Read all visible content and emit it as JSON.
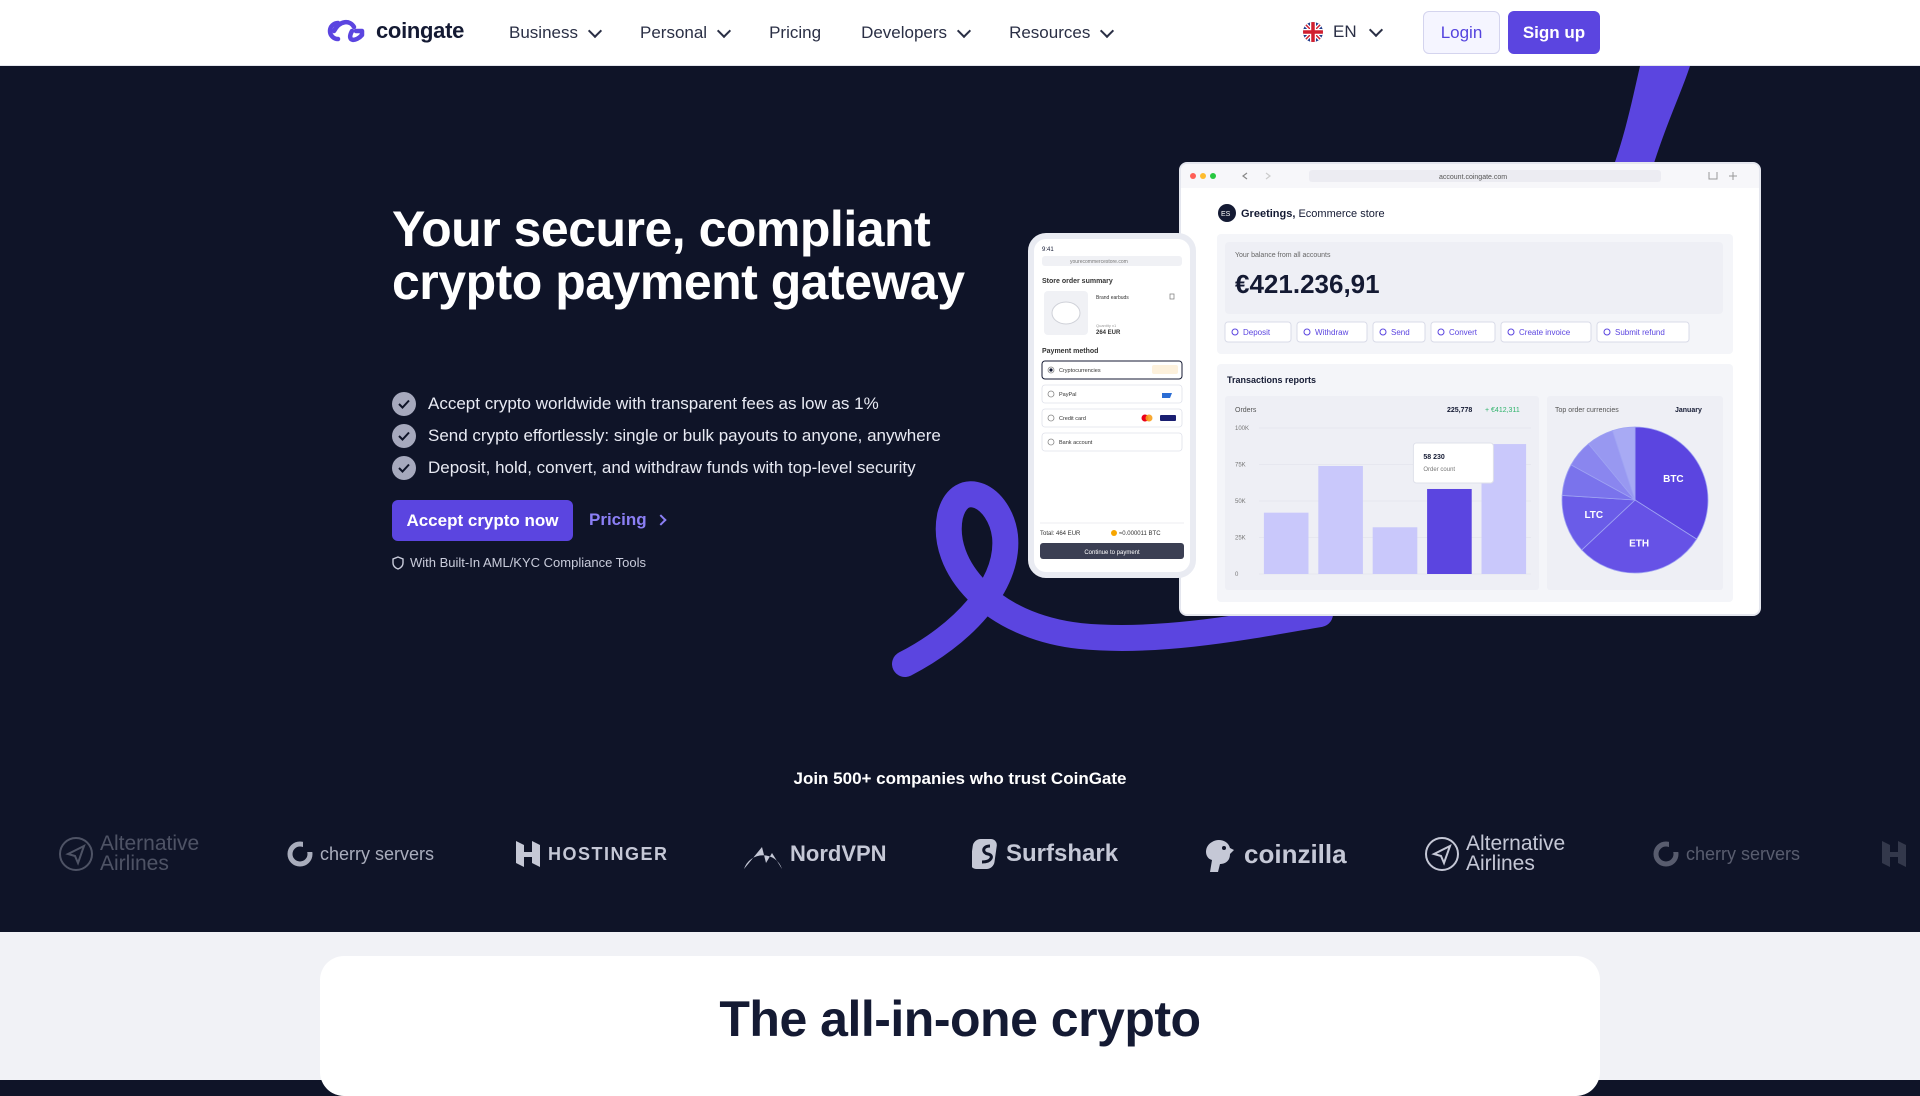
{
  "nav": {
    "brand": "coingate",
    "menu": [
      {
        "label": "Business",
        "has_dropdown": true
      },
      {
        "label": "Personal",
        "has_dropdown": true
      },
      {
        "label": "Pricing",
        "has_dropdown": false
      },
      {
        "label": "Developers",
        "has_dropdown": true
      },
      {
        "label": "Resources",
        "has_dropdown": true
      }
    ],
    "language": "EN",
    "login": "Login",
    "signup": "Sign up"
  },
  "hero": {
    "title": "Your secure, compliant crypto payment gateway",
    "bullets": [
      "Accept crypto worldwide with transparent fees as low as 1%",
      "Send crypto effortlessly: single or bulk payouts to anyone, anywhere",
      "Deposit, hold, convert, and withdraw funds with top-level security"
    ],
    "cta_primary": "Accept crypto now",
    "cta_secondary": "Pricing",
    "compliance_note": "With Built-In AML/KYC Compliance Tools"
  },
  "phone": {
    "time": "9:41",
    "url": "yourecommercestore.com",
    "summary_title": "Store order summary",
    "product": "Brand earbuds",
    "quantity": "Quantity x1",
    "price": "264 EUR",
    "payment_title": "Payment method",
    "methods": [
      "Cryptocurrencies",
      "PayPal",
      "Credit card",
      "Bank account"
    ],
    "total": "Total: 464 EUR",
    "crypto_total": "≈0.000011 BTC",
    "pay_button": "Continue to payment"
  },
  "dashboard": {
    "url": "account.coingate.com",
    "avatar": "ES",
    "greeting_bold": "Greetings,",
    "greeting_rest": " Ecommerce store",
    "balance_label": "Your balance from all accounts",
    "balance": "€421.236,91",
    "actions": [
      "Deposit",
      "Withdraw",
      "Send",
      "Convert",
      "Create invoice",
      "Submit refund"
    ],
    "reports_title": "Transactions reports",
    "orders_label": "Orders",
    "orders_count": "225,778",
    "orders_delta": "+ €412,311",
    "tooltip_value": "58 230",
    "tooltip_label": "Order count",
    "pie_title": "Top order currencies",
    "pie_period": "January"
  },
  "chart_data": [
    {
      "type": "bar",
      "title": "Orders",
      "yticks": [
        "100K",
        "75K",
        "50K",
        "25K",
        "0"
      ],
      "ylim": [
        0,
        100000
      ],
      "values": [
        42000,
        74000,
        32000,
        58230,
        89000
      ],
      "highlight_index": 3,
      "colors": {
        "bar": "#c9c8fb",
        "highlight": "#5b45e0"
      }
    },
    {
      "type": "pie",
      "title": "Top order currencies",
      "slices": [
        {
          "label": "BTC",
          "value": 34
        },
        {
          "label": "ETH",
          "value": 29
        },
        {
          "label": "LTC",
          "value": 13
        },
        {
          "label": "",
          "value": 7
        },
        {
          "label": "",
          "value": 6
        },
        {
          "label": "",
          "value": 6
        },
        {
          "label": "",
          "value": 5
        }
      ]
    }
  ],
  "trust": {
    "headline": "Join 500+ companies who trust CoinGate",
    "logos": [
      {
        "name": "Alternative Airlines",
        "icon": "paper-plane-icon"
      },
      {
        "name": "cherry servers",
        "icon": "cherry-servers-icon"
      },
      {
        "name": "HOSTINGER",
        "icon": "hostinger-h-icon"
      },
      {
        "name": "NordVPN",
        "icon": "mountain-icon"
      },
      {
        "name": "Surfshark",
        "icon": "surfshark-s-icon"
      },
      {
        "name": "coinzilla",
        "icon": "dino-icon"
      },
      {
        "name": "Alternative Airlines",
        "icon": "paper-plane-icon"
      },
      {
        "name": "cherry servers",
        "icon": "cherry-servers-icon"
      }
    ]
  },
  "section2": {
    "heading": "The all-in-one crypto"
  },
  "colors": {
    "brand": "#5b45e0",
    "hero_bg": "#0f1428",
    "accent_light": "#8b7ff5"
  }
}
